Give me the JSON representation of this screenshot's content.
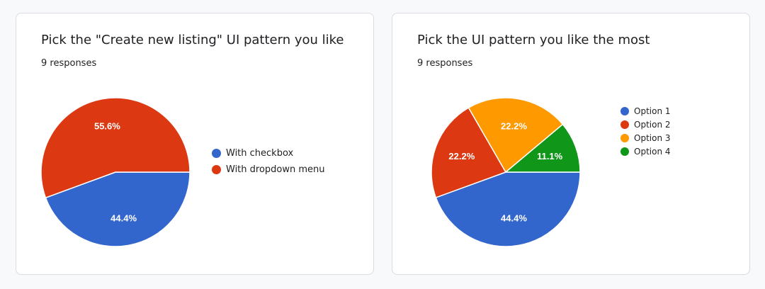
{
  "chart_data": [
    {
      "type": "pie",
      "title": "Pick the \"Create new listing\" UI pattern you like",
      "subtitle": "9 responses",
      "legend_position": "right",
      "slices": [
        {
          "label": "With checkbox",
          "value": 44.4,
          "display": "44.4%",
          "color": "#3366cc"
        },
        {
          "label": "With dropdown menu",
          "value": 55.6,
          "display": "55.6%",
          "color": "#dc3912"
        }
      ]
    },
    {
      "type": "pie",
      "title": "Pick the UI pattern you like the most",
      "subtitle": "9 responses",
      "legend_position": "right",
      "slices": [
        {
          "label": "Option 1",
          "value": 44.4,
          "display": "44.4%",
          "color": "#3366cc"
        },
        {
          "label": "Option 2",
          "value": 22.2,
          "display": "22.2%",
          "color": "#dc3912"
        },
        {
          "label": "Option 3",
          "value": 22.2,
          "display": "22.2%",
          "color": "#ff9900"
        },
        {
          "label": "Option 4",
          "value": 11.1,
          "display": "11.1%",
          "color": "#109618"
        }
      ]
    }
  ]
}
